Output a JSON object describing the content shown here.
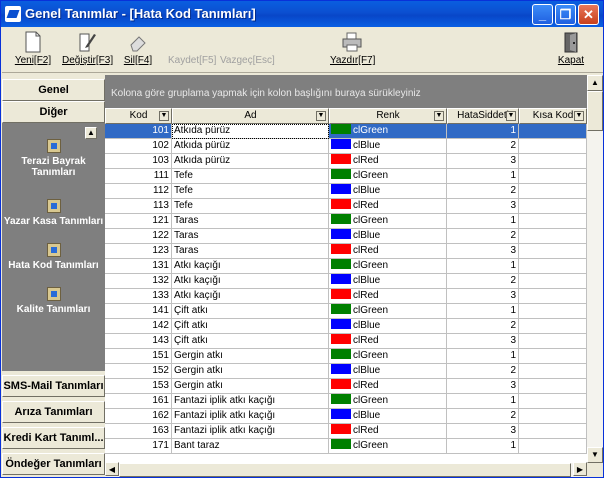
{
  "window": {
    "title": "Genel Tanımlar - [Hata Kod Tanımları]",
    "minimize": "_",
    "restore": "❐",
    "close": "✕"
  },
  "toolbar": {
    "new_label": "Yeni[F2]",
    "edit_label": "Değiştir[F3]",
    "delete_label": "Sil[F4]",
    "save_label": "Kaydet[F5]",
    "cancel_label": "Vazgeç[Esc]",
    "print_label": "Yazdır[F7]",
    "close_label": "Kapat"
  },
  "sidebar": {
    "genel": "Genel",
    "diger": "Diğer",
    "items": [
      {
        "label": "Terazi Bayrak Tanımları"
      },
      {
        "label": "Yazar Kasa Tanımları"
      },
      {
        "label": "Hata Kod Tanımları"
      },
      {
        "label": "Kalite Tanımları"
      }
    ],
    "sms": "SMS-Mail Tanımları",
    "ariza": "Arıza Tanımları",
    "kredi": "Kredi Kart Tanıml...",
    "ondeger": "Öndeğer Tanımları"
  },
  "grid": {
    "group_hint": "Kolona göre gruplama yapmak için kolon başlığını buraya sürükleyiniz",
    "columns": [
      "Kod",
      "Ad",
      "Renk",
      "HataSiddeti",
      "Kısa Kod"
    ],
    "colors": {
      "clGreen": "#008000",
      "clBlue": "#0000ff",
      "clRed": "#ff0000"
    },
    "rows": [
      {
        "kod": "101",
        "ad": "Atkıda pürüz",
        "renk": "clGreen",
        "siddet": "1"
      },
      {
        "kod": "102",
        "ad": "Atkıda pürüz",
        "renk": "clBlue",
        "siddet": "2"
      },
      {
        "kod": "103",
        "ad": "Atkıda pürüz",
        "renk": "clRed",
        "siddet": "3"
      },
      {
        "kod": "111",
        "ad": "Tefe",
        "renk": "clGreen",
        "siddet": "1"
      },
      {
        "kod": "112",
        "ad": "Tefe",
        "renk": "clBlue",
        "siddet": "2"
      },
      {
        "kod": "113",
        "ad": "Tefe",
        "renk": "clRed",
        "siddet": "3"
      },
      {
        "kod": "121",
        "ad": "Taras",
        "renk": "clGreen",
        "siddet": "1"
      },
      {
        "kod": "122",
        "ad": "Taras",
        "renk": "clBlue",
        "siddet": "2"
      },
      {
        "kod": "123",
        "ad": "Taras",
        "renk": "clRed",
        "siddet": "3"
      },
      {
        "kod": "131",
        "ad": "Atkı kaçığı",
        "renk": "clGreen",
        "siddet": "1"
      },
      {
        "kod": "132",
        "ad": "Atkı kaçığı",
        "renk": "clBlue",
        "siddet": "2"
      },
      {
        "kod": "133",
        "ad": "Atkı kaçığı",
        "renk": "clRed",
        "siddet": "3"
      },
      {
        "kod": "141",
        "ad": "Çift atkı",
        "renk": "clGreen",
        "siddet": "1"
      },
      {
        "kod": "142",
        "ad": "Çift atkı",
        "renk": "clBlue",
        "siddet": "2"
      },
      {
        "kod": "143",
        "ad": "Çift atkı",
        "renk": "clRed",
        "siddet": "3"
      },
      {
        "kod": "151",
        "ad": "Gergin atkı",
        "renk": "clGreen",
        "siddet": "1"
      },
      {
        "kod": "152",
        "ad": "Gergin atkı",
        "renk": "clBlue",
        "siddet": "2"
      },
      {
        "kod": "153",
        "ad": "Gergin atkı",
        "renk": "clRed",
        "siddet": "3"
      },
      {
        "kod": "161",
        "ad": "Fantazi iplik atkı kaçığı",
        "renk": "clGreen",
        "siddet": "1"
      },
      {
        "kod": "162",
        "ad": "Fantazi iplik atkı kaçığı",
        "renk": "clBlue",
        "siddet": "2"
      },
      {
        "kod": "163",
        "ad": "Fantazi iplik atkı kaçığı",
        "renk": "clRed",
        "siddet": "3"
      },
      {
        "kod": "171",
        "ad": "Bant taraz",
        "renk": "clGreen",
        "siddet": "1"
      }
    ]
  }
}
